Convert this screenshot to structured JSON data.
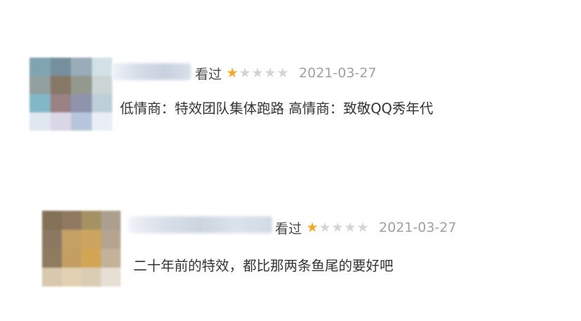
{
  "reviews": [
    {
      "watched_label": "看过",
      "rating": 1,
      "max_rating": 5,
      "date": "2021-03-27",
      "comment": "低情商：特效团队集体跑路 高情商：致敬QQ秀年代",
      "avatar_colors": [
        "#7aa0ac",
        "#6f8a98",
        "#93a9b4",
        "#cfe0e5",
        "#8c9a9a",
        "#80705f",
        "#8e9488",
        "#c9d3d1",
        "#7cb4c4",
        "#957b7e",
        "#8a8ea8",
        "#b9ced8",
        "#dfe6ee",
        "#d8d4e4",
        "#b4c4dc",
        "#e9eef5"
      ]
    },
    {
      "watched_label": "看过",
      "rating": 1,
      "max_rating": 5,
      "date": "2021-03-27",
      "comment": "二十年前的特效，都比那两条鱼尾的要好吧",
      "avatar_colors": [
        "#7e6a52",
        "#8a7258",
        "#a08c5c",
        "#a89a88",
        "#86705a",
        "#c39c5e",
        "#caa056",
        "#b0a08a",
        "#8a7456",
        "#c09a5c",
        "#d1a24e",
        "#bfae94",
        "#d6c6aa",
        "#e0cfae",
        "#d9cbb0",
        "#e6ded2"
      ]
    }
  ]
}
